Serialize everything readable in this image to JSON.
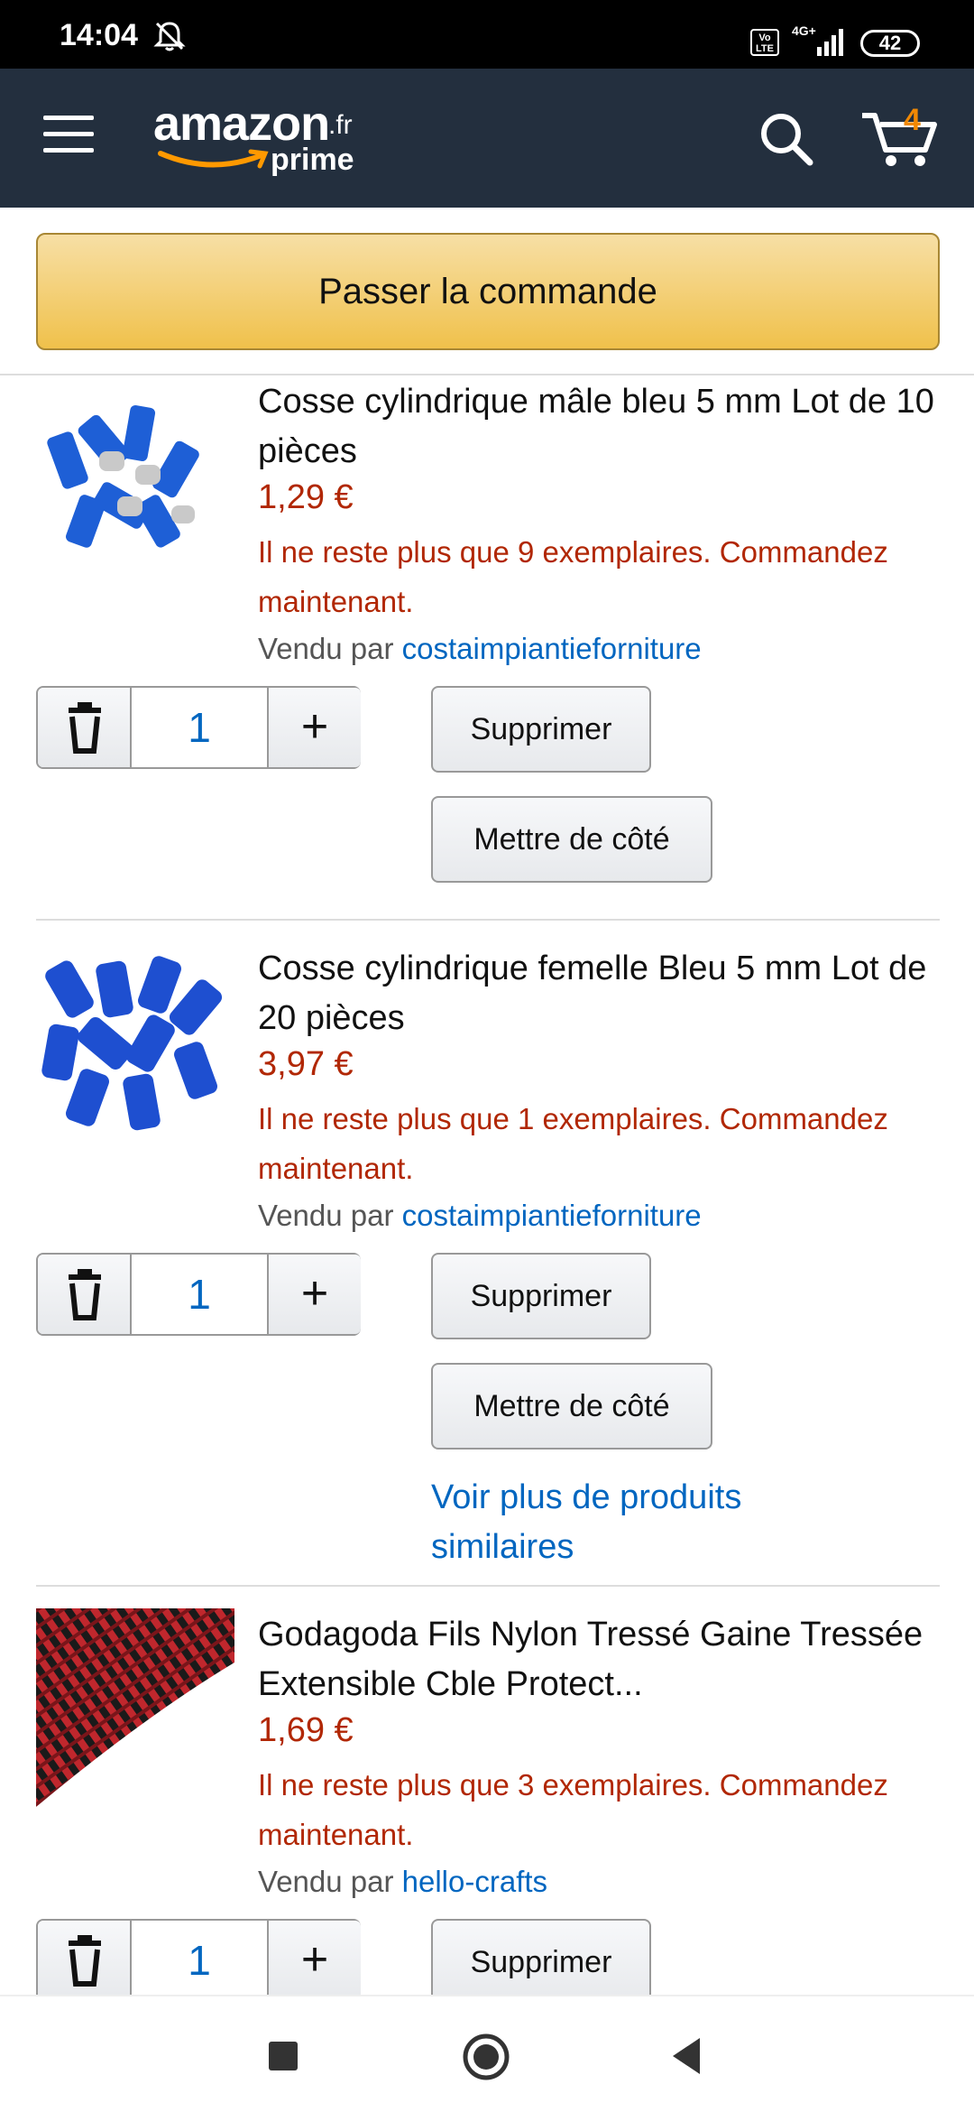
{
  "status_bar": {
    "time": "14:04",
    "network": "4G+",
    "volte": "Vo LTE",
    "battery": "42"
  },
  "header": {
    "logo": {
      "word": "amazon",
      "tld": ".fr",
      "prime": "prime"
    },
    "cart_count": "4",
    "icons": [
      "menu-icon",
      "search-icon",
      "cart-icon"
    ]
  },
  "checkout": {
    "label": "Passer la commande"
  },
  "items": [
    {
      "title": "Cosse cylindrique mâle bleu 5 mm Lot de 10 pièces",
      "price": "1,29 €",
      "stock": "Il ne reste plus que 9 exemplaires. Commandez maintenant.",
      "seller_prefix": "Vendu par",
      "seller": "costaimpiantieforniture",
      "quantity": "1",
      "remove_label": "Supprimer",
      "save_label": "Mettre de côté"
    },
    {
      "title": "Cosse cylindrique femelle Bleu 5 mm Lot de 20 pièces",
      "price": "3,97 €",
      "stock": "Il ne reste plus que 1 exemplaires. Commandez maintenant.",
      "seller_prefix": "Vendu par",
      "seller": "costaimpiantieforniture",
      "quantity": "1",
      "remove_label": "Supprimer",
      "save_label": "Mettre de côté",
      "more_link": "Voir plus de produits similaires"
    },
    {
      "title": "Godagoda Fils Nylon Tressé Gaine Tressée Extensible Cble Protect...",
      "price": "1,69 €",
      "stock": "Il ne reste plus que 3 exemplaires. Commandez maintenant.",
      "seller_prefix": "Vendu par",
      "seller": "hello-crafts",
      "quantity": "1",
      "remove_label": "Supprimer"
    }
  ],
  "colors": {
    "header": "#232f3e",
    "price": "#b12704",
    "link": "#0066c0",
    "button": "#f0c14b",
    "cart_count": "#f08804"
  }
}
